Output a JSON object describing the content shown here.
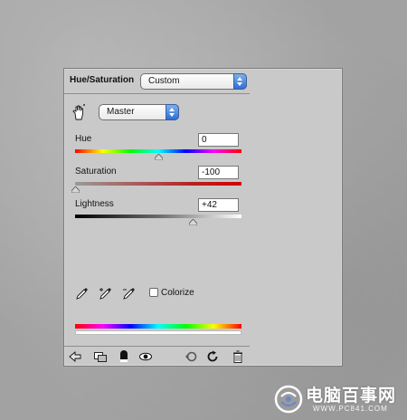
{
  "dialog": {
    "title": "Hue/Saturation",
    "preset": "Custom",
    "channel": "Master"
  },
  "sliders": [
    {
      "label": "Hue",
      "value": "0",
      "level": 0.5
    },
    {
      "label": "Saturation",
      "value": "-100",
      "level": 0.0
    },
    {
      "label": "Lightness",
      "value": "+42",
      "level": 0.71
    }
  ],
  "colorize": {
    "label": "Colorize",
    "checked": false
  },
  "icons": {
    "channel_tool": "hand-adjust-icon",
    "eyedroppers": [
      "eyedropper-icon",
      "eyedropper-plus-icon",
      "eyedropper-minus-icon"
    ],
    "footer": [
      "back-icon",
      "clip-layer-icon",
      "mask-icon",
      "visibility-eye-icon",
      "previous-state-icon",
      "reset-icon",
      "delete-icon"
    ]
  },
  "colors": {
    "panel_bg": "#c9c9c9",
    "accent": "#2f6fd4"
  },
  "watermark": {
    "text": "电脑百事网",
    "url": "WWW.PC841.COM"
  }
}
